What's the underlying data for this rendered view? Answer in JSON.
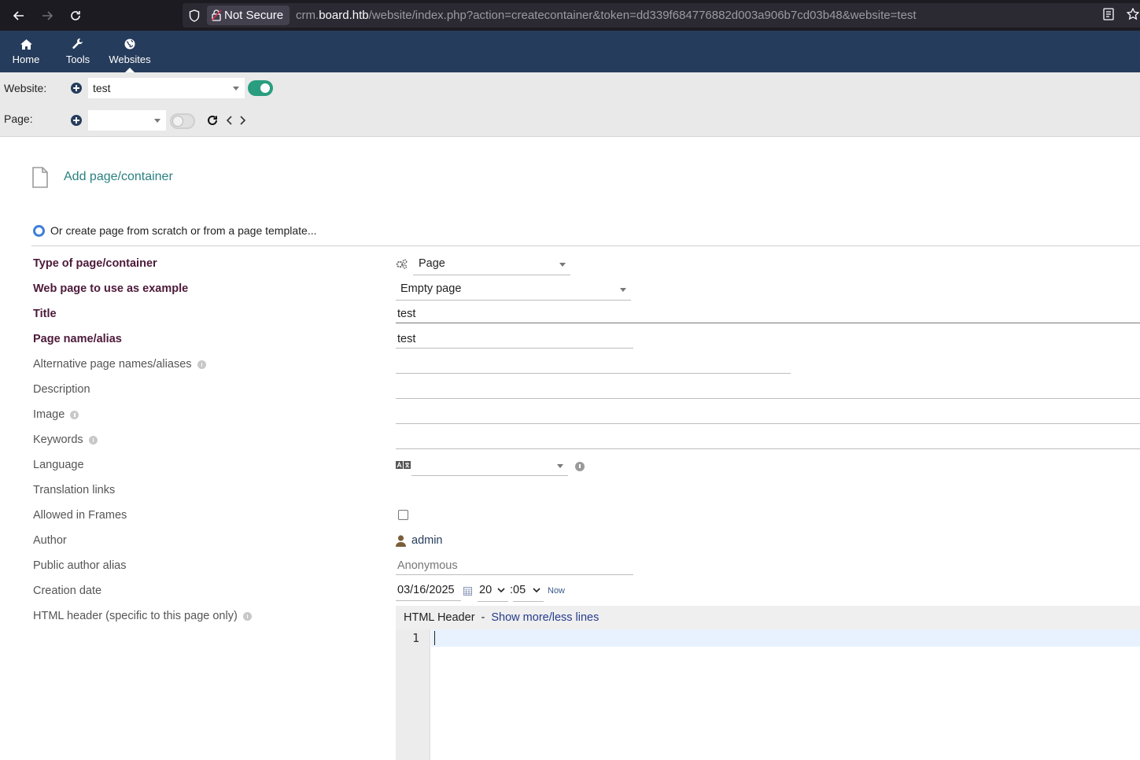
{
  "browser": {
    "not_secure_label": "Not Secure",
    "url_host_prefix": "crm.",
    "url_host": "board.htb",
    "url_path": "/website/index.php?action=createcontainer&token=dd339f684776882d003a906b7cd03b48&website=test"
  },
  "topmenu": {
    "items": [
      {
        "label": "Home",
        "icon": "home-icon"
      },
      {
        "label": "Tools",
        "icon": "wrench-icon"
      },
      {
        "label": "Websites",
        "icon": "globe-icon"
      }
    ]
  },
  "toolbar": {
    "website_label": "Website:",
    "website_value": "test",
    "page_label": "Page:",
    "page_value": ""
  },
  "main": {
    "title": "Add page/container",
    "radio_label": "Or create page from scratch or from a page template...",
    "fields": {
      "type_label": "Type of page/container",
      "type_value": "Page",
      "example_label": "Web page to use as example",
      "example_value": "Empty page",
      "title_label": "Title",
      "title_value": "test",
      "pagename_label": "Page name/alias",
      "pagename_value": "test",
      "altnames_label": "Alternative page names/aliases",
      "description_label": "Description",
      "image_label": "Image",
      "keywords_label": "Keywords",
      "language_label": "Language",
      "translation_label": "Translation links",
      "frames_label": "Allowed in Frames",
      "author_label": "Author",
      "author_value": "admin",
      "public_alias_label": "Public author alias",
      "public_alias_placeholder": "Anonymous",
      "creation_label": "Creation date",
      "creation_date": "03/16/2025",
      "creation_hour": "20",
      "creation_minute": ":05",
      "now_label": "Now",
      "htmlheader_label": "HTML header (specific to this page only)"
    },
    "editor": {
      "header_title": "HTML Header",
      "separator": "-",
      "toggle_link": "Show more/less lines",
      "line_number": "1"
    }
  },
  "colors": {
    "topmenu_bg": "#263c5c",
    "accent_teal": "#2a8080",
    "required_label": "#4d1a3a",
    "toggle_on": "#2a9d7f"
  }
}
